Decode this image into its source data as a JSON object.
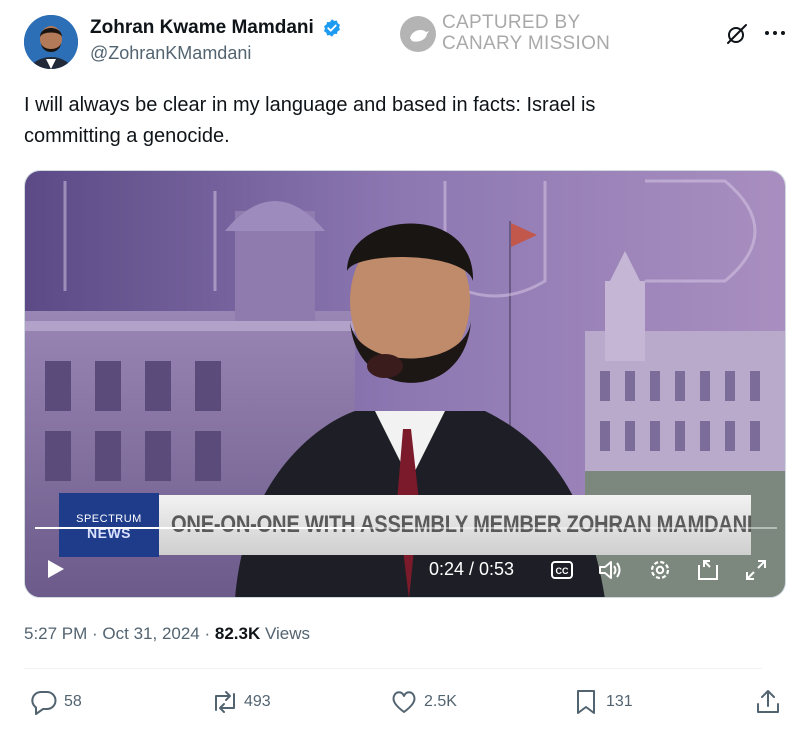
{
  "author": {
    "display_name": "Zohran Kwame Mamdani",
    "handle": "@ZohranKMamdani",
    "avatar_icon": "profile-photo",
    "verified_color": "#1d9bf0"
  },
  "watermark": {
    "line1": "CAPTURED BY",
    "line2": "CANARY MISSION"
  },
  "tweet": {
    "text_line1": "I will always be clear in my language and based in facts: Israel is",
    "text_line2": "committing a genocide."
  },
  "video": {
    "lower_third": {
      "logo_line1": "SPECTRUM",
      "logo_line2": "NEWS",
      "title": "ONE-ON-ONE WITH ASSEMBLY MEMBER ZOHRAN MAMDANI"
    },
    "time": "0:24 / 0:53",
    "progress": 0.45,
    "controls": [
      "play-icon",
      "captions-icon",
      "volume-icon",
      "settings-icon",
      "pip-icon",
      "fullscreen-icon"
    ]
  },
  "meta": {
    "time": "5:27 PM",
    "sep1": " · ",
    "date": "Oct 31, 2024",
    "sep2": " · ",
    "views_count": "82.3K",
    "views_label": " Views"
  },
  "actions": {
    "replies": "58",
    "reposts": "493",
    "likes": "2.5K",
    "bookmarks": "131"
  }
}
